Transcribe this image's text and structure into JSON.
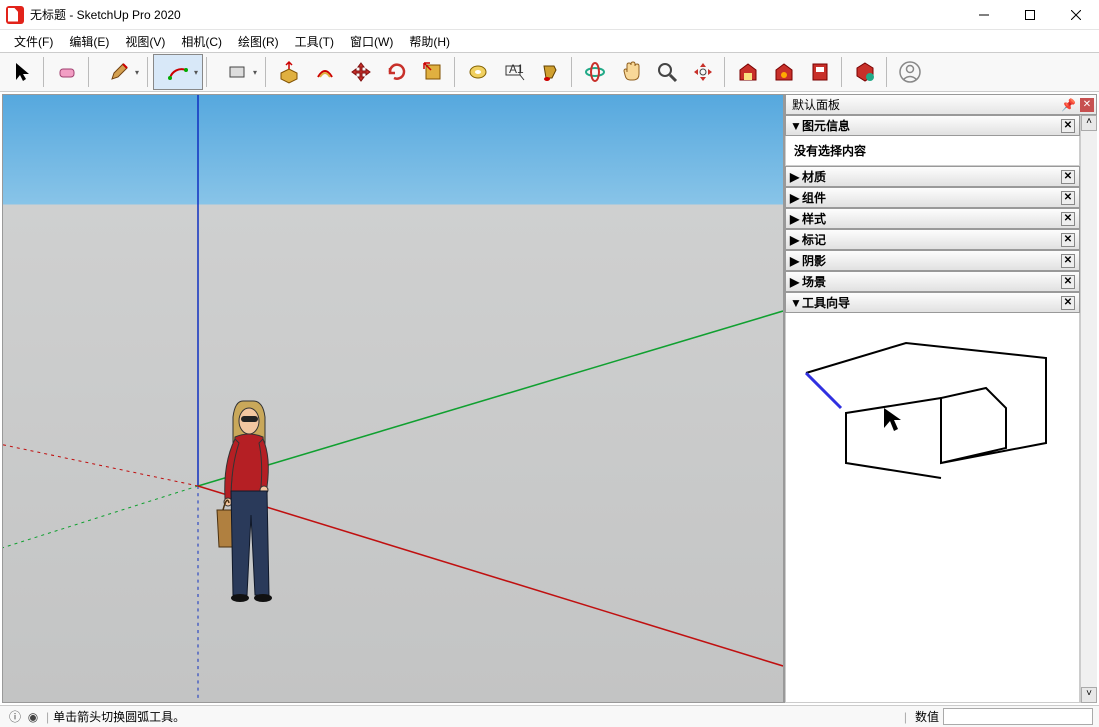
{
  "titlebar": {
    "title": "无标题 - SketchUp Pro 2020"
  },
  "menu": {
    "items": [
      {
        "label": "文件(F)"
      },
      {
        "label": "编辑(E)"
      },
      {
        "label": "视图(V)"
      },
      {
        "label": "相机(C)"
      },
      {
        "label": "绘图(R)"
      },
      {
        "label": "工具(T)"
      },
      {
        "label": "窗口(W)"
      },
      {
        "label": "帮助(H)"
      }
    ]
  },
  "toolbar": {
    "tools": [
      {
        "name": "select-tool",
        "dd": false
      },
      {
        "name": "eraser-tool",
        "dd": false
      },
      {
        "name": "pencil-tool",
        "dd": true
      },
      {
        "name": "arc-tool",
        "dd": true,
        "active": true
      },
      {
        "name": "shape-tool",
        "dd": true
      },
      {
        "name": "pushpull-tool",
        "dd": false
      },
      {
        "name": "offset-tool",
        "dd": false
      },
      {
        "name": "move-tool",
        "dd": false
      },
      {
        "name": "rotate-tool",
        "dd": false
      },
      {
        "name": "scale-tool",
        "dd": false
      },
      {
        "name": "tape-tool",
        "dd": false
      },
      {
        "name": "text-tool",
        "dd": false
      },
      {
        "name": "paint-tool",
        "dd": false
      },
      {
        "name": "orbit-tool",
        "dd": false
      },
      {
        "name": "pan-tool",
        "dd": false
      },
      {
        "name": "zoom-tool",
        "dd": false
      },
      {
        "name": "zoom-extents-tool",
        "dd": false
      },
      {
        "name": "warehouse-tool",
        "dd": false
      },
      {
        "name": "extension-tool",
        "dd": false
      },
      {
        "name": "layout-tool",
        "dd": false
      },
      {
        "name": "ruby-tool",
        "dd": false
      },
      {
        "name": "user-tool",
        "dd": false
      }
    ]
  },
  "sidepanel": {
    "title": "默认面板",
    "sections": {
      "entity_info": {
        "label": "图元信息",
        "expanded": true,
        "body": "没有选择内容"
      },
      "materials": {
        "label": "材质",
        "expanded": false
      },
      "components": {
        "label": "组件",
        "expanded": false
      },
      "styles": {
        "label": "样式",
        "expanded": false
      },
      "tags": {
        "label": "标记",
        "expanded": false
      },
      "shadows": {
        "label": "阴影",
        "expanded": false
      },
      "scenes": {
        "label": "场景",
        "expanded": false
      },
      "instructor": {
        "label": "工具向导",
        "expanded": true
      }
    }
  },
  "statusbar": {
    "hint": "单击箭头切换圆弧工具。",
    "value_label": "数值"
  }
}
